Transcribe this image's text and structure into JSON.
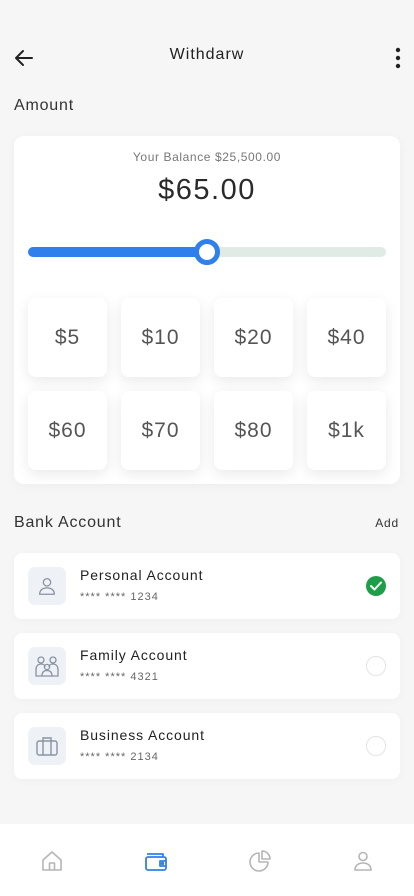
{
  "header": {
    "title": "Withdarw",
    "back_icon": "arrow-left-icon",
    "more_icon": "more-vertical-icon"
  },
  "amount": {
    "label": "Amount",
    "balance_text": "Your Balance $25,500.00",
    "value": "$65.00",
    "slider_fraction": 0.5,
    "accent_color": "#2f80ed",
    "quick_amounts": [
      "$5",
      "$10",
      "$20",
      "$40",
      "$60",
      "$70",
      "$80",
      "$1k"
    ]
  },
  "bank": {
    "label": "Bank Account",
    "add_label": "Add",
    "accounts": [
      {
        "name": "Personal Account",
        "number": "**** **** 1234",
        "icon": "user-icon",
        "selected": true
      },
      {
        "name": "Family Account",
        "number": "**** **** 4321",
        "icon": "family-icon",
        "selected": false
      },
      {
        "name": "Business Account",
        "number": "**** **** 2134",
        "icon": "briefcase-icon",
        "selected": false
      }
    ],
    "selected_color": "#1f9e4a"
  },
  "nav": {
    "items": [
      {
        "icon": "home-icon",
        "active": false
      },
      {
        "icon": "wallet-icon",
        "active": true
      },
      {
        "icon": "pie-chart-icon",
        "active": false
      },
      {
        "icon": "profile-icon",
        "active": false
      }
    ],
    "active_color": "#2f80ed",
    "inactive_color": "#b5b5b5"
  }
}
